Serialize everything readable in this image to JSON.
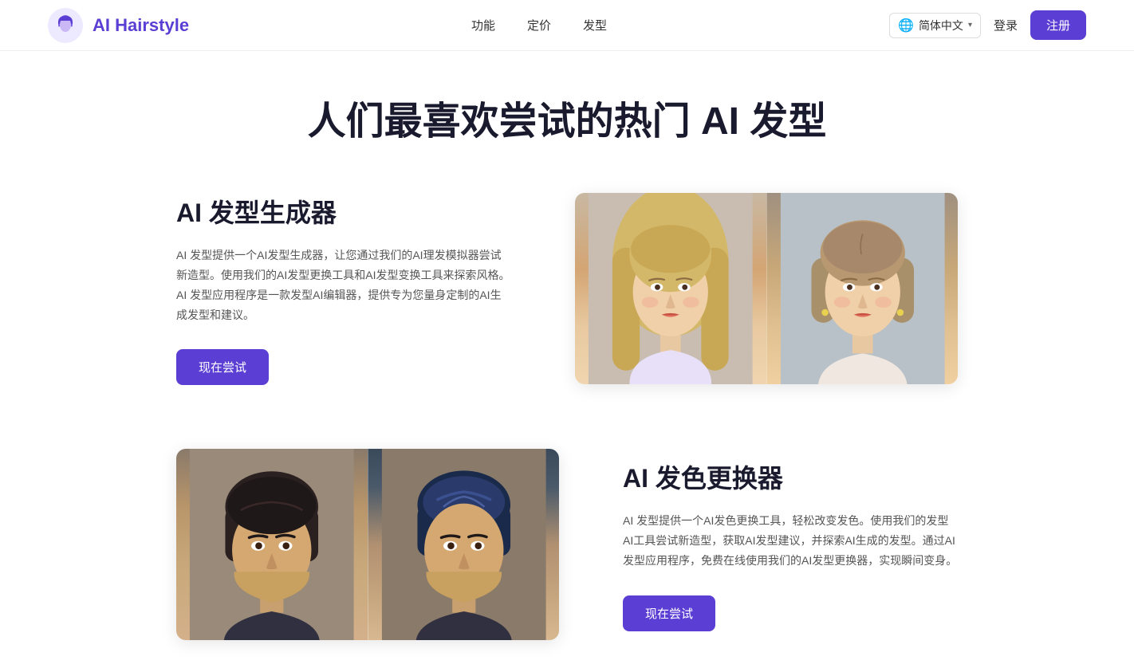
{
  "brand": {
    "name": "AI Hairstyle",
    "logo_alt": "AI Hairstyle logo"
  },
  "navbar": {
    "links": [
      {
        "label": "功能",
        "id": "features"
      },
      {
        "label": "定价",
        "id": "pricing"
      },
      {
        "label": "发型",
        "id": "hairstyle"
      }
    ],
    "language": "简体中文",
    "login_label": "登录",
    "register_label": "注册"
  },
  "hero": {
    "title": "人们最喜欢尝试的热门 AI 发型"
  },
  "section1": {
    "heading": "AI 发型生成器",
    "description": "AI 发型提供一个AI发型生成器，让您通过我们的AI理发模拟器尝试新造型。使用我们的AI发型更换工具和AI发型变换工具来探索风格。AI 发型应用程序是一款发型AI编辑器，提供专为您量身定制的AI生成发型和建议。",
    "cta": "现在尝试"
  },
  "section2": {
    "heading": "AI 发色更换器",
    "description": "AI 发型提供一个AI发色更换工具，轻松改变发色。使用我们的发型AI工具尝试新造型，获取AI发型建议，并探索AI生成的发型。通过AI发型应用程序，免费在线使用我们的AI发型更换器，实现瞬间变身。",
    "cta": "现在尝试"
  },
  "colors": {
    "accent": "#5b3fd4",
    "text_dark": "#1a1a2e",
    "text_muted": "#555555"
  }
}
